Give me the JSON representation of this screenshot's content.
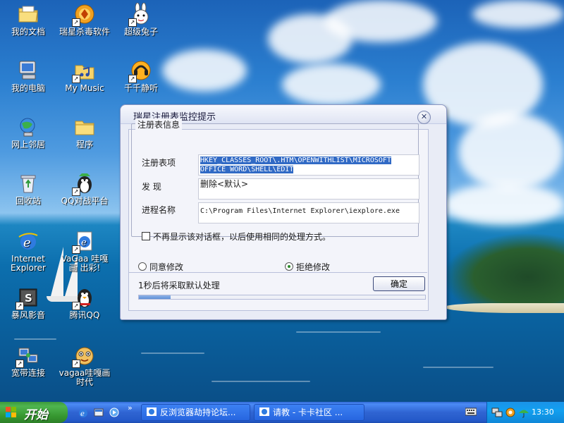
{
  "desktop": {
    "icons": [
      {
        "label": "我的文档",
        "icon": "my-documents-icon"
      },
      {
        "label": "瑞星杀毒软件",
        "icon": "rising-antivirus-icon"
      },
      {
        "label": "超级兔子",
        "icon": "super-rabbit-icon"
      },
      {
        "label": "我的电脑",
        "icon": "my-computer-icon"
      },
      {
        "label": "My Music",
        "icon": "my-music-icon"
      },
      {
        "label": "千千静听",
        "icon": "ttplayer-icon"
      },
      {
        "label": "网上邻居",
        "icon": "network-places-icon"
      },
      {
        "label": "程序",
        "icon": "folder-icon"
      },
      {
        "label": "回收站",
        "icon": "recycle-bin-icon"
      },
      {
        "label": "QQ对战平台",
        "icon": "qq-battle-icon"
      },
      {
        "label": "Internet Explorer",
        "icon": "ie-icon"
      },
      {
        "label": "VaGaa 哇嘎画 出彩!",
        "icon": "vagaa-ie-icon"
      },
      {
        "label": "暴风影音",
        "icon": "storm-player-icon"
      },
      {
        "label": "腾讯QQ",
        "icon": "qq-penguin-icon"
      },
      {
        "label": "宽带连接",
        "icon": "broadband-icon"
      },
      {
        "label": "vagaa哇嘎画 时代",
        "icon": "vagaa-mascot-icon"
      }
    ]
  },
  "dialog": {
    "title": "瑞星注册表监控提示",
    "group_title": "注册表信息",
    "registry_label": "注册表项",
    "registry_value": "HKEY_CLASSES_ROOT\\.HTM\\OPENWITHLIST\\MICROSOFT OFFICE WORD\\SHELL\\EDIT",
    "found_label": "发    现",
    "found_value": "删除<默认>",
    "process_label": "进程名称",
    "process_value": "C:\\Program Files\\Internet Explorer\\iexplore.exe",
    "checkbox_label": "不再显示该对话框，以后使用相同的处理方式。",
    "checkbox_checked": false,
    "radio_agree": "同意修改",
    "radio_reject": "拒绝修改",
    "selected_option": "拒绝修改",
    "status_text": "1秒后将采取默认处理",
    "ok_button": "确定",
    "progress_fraction": 0.11
  },
  "taskbar": {
    "start_label": "开始",
    "tasks": [
      {
        "label": "反浏览器劫持论坛...",
        "icon": "ie-icon"
      },
      {
        "label": "请教 - 卡卡社区 ...",
        "icon": "ie-icon"
      }
    ],
    "clock": "13:30"
  }
}
